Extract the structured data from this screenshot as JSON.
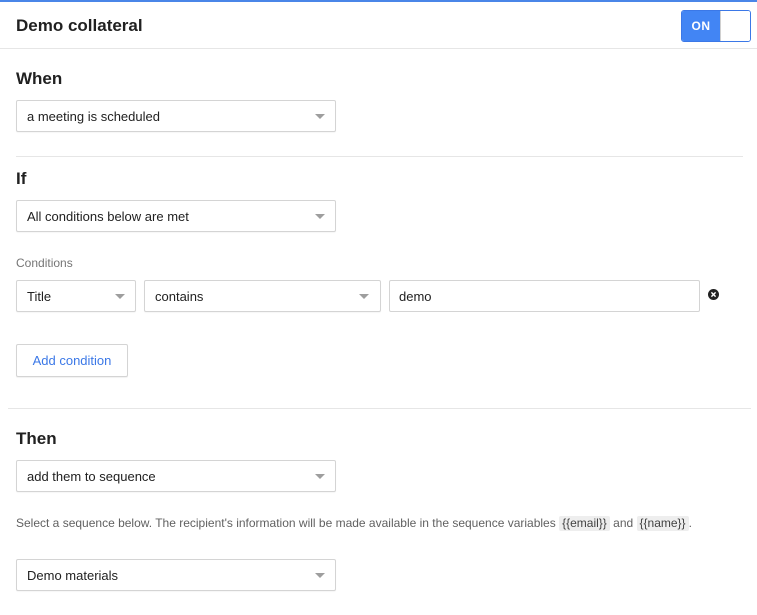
{
  "header": {
    "title": "Demo collateral",
    "toggle_label": "ON"
  },
  "when": {
    "title": "When",
    "trigger": "a meeting is scheduled"
  },
  "if": {
    "title": "If",
    "match_mode": "All conditions below are met",
    "conditions_label": "Conditions",
    "condition": {
      "field": "Title",
      "operator": "contains",
      "value": "demo"
    },
    "add_condition_label": "Add condition"
  },
  "then": {
    "title": "Then",
    "action": "add them to sequence",
    "help_prefix": "Select a sequence below. The recipient's information will be made available in the sequence variables",
    "var_email": "{{email}}",
    "help_and": "and",
    "var_name": "{{name}}",
    "help_suffix": ".",
    "sequence": "Demo materials"
  },
  "colors": {
    "accent": "#4285f4",
    "link": "#3b78e7",
    "border": "#d4d4d4",
    "divider": "#e6e6e6"
  },
  "icons": {
    "caret": "chevron-down-icon",
    "remove": "close-circle-icon"
  }
}
